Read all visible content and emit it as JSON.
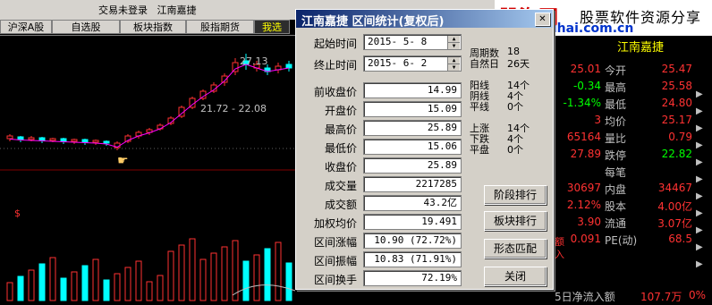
{
  "window": {
    "trade_login": "交易未登录",
    "stock_name": "江南嘉捷"
  },
  "tabs": [
    "沪深A股",
    "自选股",
    "板块指数",
    "股指期货",
    "我选"
  ],
  "chart_labels": {
    "high_price": "27.13",
    "range_label": "21.72 - 22.08",
    "marker": "$"
  },
  "logo": {
    "brand": "股海网",
    "slogan": "股票软件资源分享",
    "url": "www.Guhai.com.cn"
  },
  "dialog": {
    "title": "江南嘉捷  区间统计(复权后)",
    "close_glyph": "✕",
    "start_label": "起始时间",
    "start_value": "2015- 5- 8",
    "end_label": "终止时间",
    "end_value": "2015- 6- 2",
    "fields": [
      {
        "label": "前收盘价",
        "value": "14.99"
      },
      {
        "label": "开盘价",
        "value": "15.09"
      },
      {
        "label": "最高价",
        "value": "25.89"
      },
      {
        "label": "最低价",
        "value": "15.06"
      },
      {
        "label": "收盘价",
        "value": "25.89"
      },
      {
        "label": "成交量",
        "value": "2217285"
      },
      {
        "label": "成交额",
        "value": "43.2亿"
      },
      {
        "label": "加权均价",
        "value": "19.491"
      },
      {
        "label": "区间涨幅",
        "value": "10.90 (72.72%)"
      },
      {
        "label": "区间振幅",
        "value": "10.83 (71.91%)"
      },
      {
        "label": "区间换手",
        "value": "72.19%"
      }
    ],
    "stats_period": [
      {
        "label": "周期数",
        "value": "18"
      },
      {
        "label": "自然日",
        "value": "26天"
      }
    ],
    "stats_candles": [
      {
        "label": "阳线",
        "value": "14个"
      },
      {
        "label": "阴线",
        "value": "4个"
      },
      {
        "label": "平线",
        "value": "0个"
      }
    ],
    "stats_moves": [
      {
        "label": "上涨",
        "value": "14个"
      },
      {
        "label": "下跌",
        "value": "4个"
      },
      {
        "label": "平盘",
        "value": "0个"
      }
    ],
    "buttons": [
      "阶段排行",
      "板块排行",
      "形态匹配",
      "关闭"
    ]
  },
  "quote": {
    "header": "江南嘉捷",
    "rows": [
      {
        "v1": "25.01",
        "l": "今开",
        "v2": "25.47"
      },
      {
        "v1": "-0.34",
        "l": "最高",
        "v2": "25.58"
      },
      {
        "v1": "-1.34%",
        "l": "最低",
        "v2": "24.80"
      },
      {
        "v1": "3",
        "l": "均价",
        "v2": "25.17"
      },
      {
        "v1": "65164",
        "l": "量比",
        "v2": "0.79"
      },
      {
        "v1": "27.89",
        "l": "跌停",
        "v2": "22.82"
      },
      {
        "v1": "",
        "l": "每笔",
        "v2": ""
      },
      {
        "v1": "30697",
        "l": "内盘",
        "v2": "34467"
      },
      {
        "v1": "2.12%",
        "l": "股本",
        "v2": "4.00亿"
      },
      {
        "v1": "3.90",
        "l": "流通",
        "v2": "3.07亿"
      },
      {
        "v1": "0.091",
        "l": "PE(动)",
        "v2": "68.5"
      }
    ],
    "bottom_line": "5日净流入额",
    "bottom_value": "107.7万",
    "bottom_pct": "0%"
  },
  "colors": {
    "up": "#ff3232",
    "down": "#00ffff",
    "label": "#c0c0c0",
    "title_bar": "#0a246a"
  }
}
